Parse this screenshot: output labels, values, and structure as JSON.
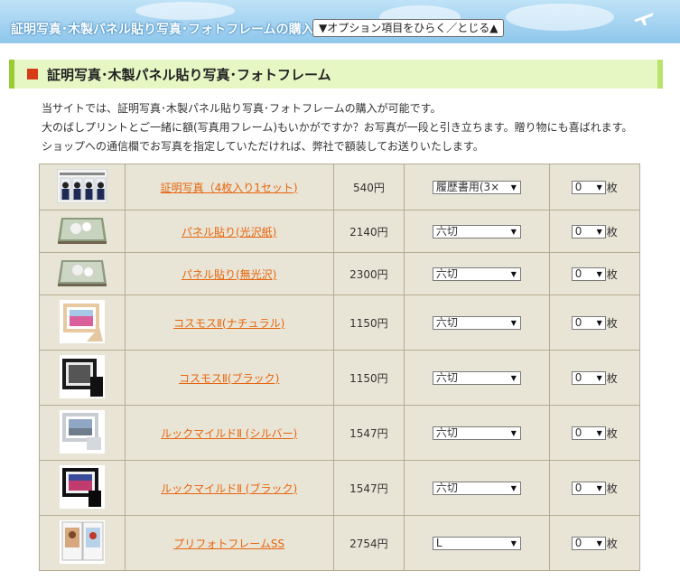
{
  "header": {
    "title": "証明写真･木製パネル貼り写真･フォトフレームの購入",
    "option_toggle": "▼オプション項目をひらく／とじる▲"
  },
  "section": {
    "title": "証明写真･木製パネル貼り写真･フォトフレーム"
  },
  "intro": [
    "当サイトでは、証明写真･木製パネル貼り写真･フォトフレームの購入が可能です。",
    "大のばしプリントとご一緒に額(写真用フレーム)もいかがですか？お写真が一段と引き立ちます。贈り物にも喜ばれます。",
    "ショップへの通信欄でお写真を指定していただければ、弊社で額装してお送りいたします。"
  ],
  "products": [
    {
      "name": "証明写真（4枚入り1セット)",
      "price": "540円",
      "size": "履歴書用(3×",
      "qty": "0",
      "unit": "枚",
      "thumb": "id-photo"
    },
    {
      "name": "パネル貼り(光沢紙)",
      "price": "2140円",
      "size": "六切",
      "qty": "0",
      "unit": "枚",
      "thumb": "panel-glossy"
    },
    {
      "name": "パネル貼り(無光沢)",
      "price": "2300円",
      "size": "六切",
      "qty": "0",
      "unit": "枚",
      "thumb": "panel-matte"
    },
    {
      "name": "コスモスⅡ(ナチュラル)",
      "price": "1150円",
      "size": "六切",
      "qty": "0",
      "unit": "枚",
      "thumb": "frame-natural"
    },
    {
      "name": "コスモスⅡ(ブラック)",
      "price": "1150円",
      "size": "六切",
      "qty": "0",
      "unit": "枚",
      "thumb": "frame-black"
    },
    {
      "name": "ルックマイルドⅡ (シルバー)",
      "price": "1547円",
      "size": "六切",
      "qty": "0",
      "unit": "枚",
      "thumb": "frame-silver"
    },
    {
      "name": "ルックマイルドⅡ (ブラック)",
      "price": "1547円",
      "size": "六切",
      "qty": "0",
      "unit": "枚",
      "thumb": "frame-black-photo"
    },
    {
      "name": "プリフォトフレームSS",
      "price": "2754円",
      "size": "L",
      "qty": "0",
      "unit": "枚",
      "thumb": "frame-stand"
    }
  ],
  "colors": {
    "link": "#e6650f",
    "table_bg": "#e9e5d6",
    "section_bg": "#e7f7c4",
    "accent": "#d63a16"
  }
}
